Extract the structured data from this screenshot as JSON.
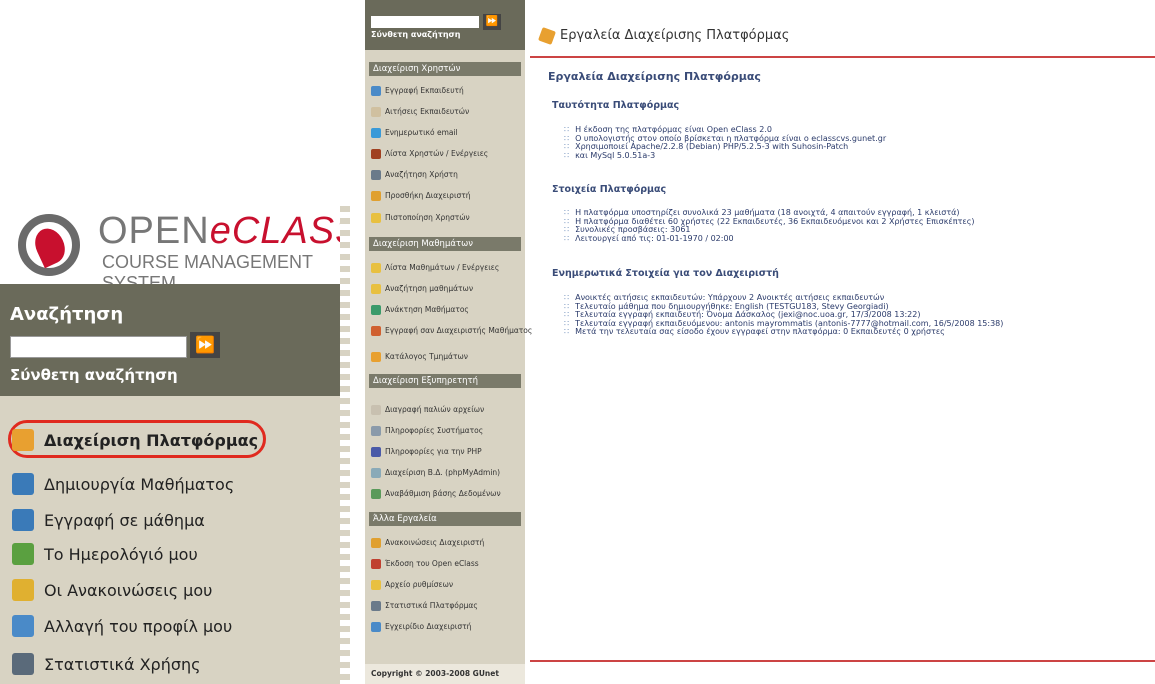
{
  "zoom": {
    "logo_main_a": "OPEN",
    "logo_main_b": "eCLASS",
    "logo_sub": "COURSE MANAGEMENT SYSTEM",
    "search_heading": "Αναζήτηση",
    "search_button": "⏩",
    "advanced_search": "Σύνθετη αναζήτηση",
    "menu": [
      {
        "label": "Διαχείριση Πλατφόρμας",
        "icon": "tools-icon",
        "color": "#e8a030"
      },
      {
        "label": "Δημιουργία Μαθήματος",
        "icon": "course-icon",
        "color": "#3a7ab8"
      },
      {
        "label": "Εγγραφή σε μάθημα",
        "icon": "enroll-icon",
        "color": "#3a7ab8"
      },
      {
        "label": "Το Ημερολόγιό μου",
        "icon": "calendar-icon",
        "color": "#5aa040"
      },
      {
        "label": "Οι Ανακοινώσεις μου",
        "icon": "announcement-icon",
        "color": "#e0b030"
      },
      {
        "label": "Αλλαγή του προφίλ μου",
        "icon": "profile-icon",
        "color": "#4a8ac8"
      },
      {
        "label": "Στατιστικά Χρήσης",
        "icon": "stats-icon",
        "color": "#5a6a7a"
      }
    ]
  },
  "sidebar": {
    "search_button": "⏩",
    "advanced_search": "Σύνθετη αναζήτηση",
    "sections": [
      {
        "title": "Διαχείριση Χρηστών",
        "items": [
          {
            "label": "Εγγραφή Εκπαιδευτή",
            "color": "#4a8ac8"
          },
          {
            "label": "Αιτήσεις Εκπαιδευτών",
            "color": "#d0c0a0"
          },
          {
            "label": "Ενημερωτικό email",
            "color": "#3a9ad8"
          },
          {
            "label": "Λίστα Χρηστών / Ενέργειες",
            "color": "#a04020"
          },
          {
            "label": "Αναζήτηση Χρήστη",
            "color": "#6a7a8a"
          },
          {
            "label": "Προσθήκη Διαχειριστή",
            "color": "#e0a030"
          },
          {
            "label": "Πιστοποίηση Χρηστών",
            "color": "#e8c040"
          }
        ]
      },
      {
        "title": "Διαχείριση Μαθημάτων",
        "items": [
          {
            "label": "Λίστα Μαθημάτων / Ενέργειες",
            "color": "#e8c040"
          },
          {
            "label": "Αναζήτηση μαθημάτων",
            "color": "#e8c040"
          },
          {
            "label": "Ανάκτηση Μαθήματος",
            "color": "#3a9a6a"
          },
          {
            "label": "Εγγραφή σαν Διαχειριστής Μαθήματος",
            "color": "#d06030"
          },
          {
            "label": "Κατάλογος Τμημάτων",
            "color": "#e8a030"
          }
        ]
      },
      {
        "title": "Διαχείριση Εξυπηρετητή",
        "items": [
          {
            "label": "Διαγραφή παλιών αρχείων",
            "color": "#c8c0b0"
          },
          {
            "label": "Πληροφορίες Συστήματος",
            "color": "#8a9aaa"
          },
          {
            "label": "Πληροφορίες για την PHP",
            "color": "#4a5aa8"
          },
          {
            "label": "Διαχείριση Β.Δ. (phpMyAdmin)",
            "color": "#8aaab8"
          },
          {
            "label": "Αναβάθμιση βάσης Δεδομένων",
            "color": "#5a9a5a"
          }
        ]
      },
      {
        "title": "Άλλα Εργαλεία",
        "items": [
          {
            "label": "Ανακοινώσεις Διαχειριστή",
            "color": "#e0a030"
          },
          {
            "label": "Έκδοση του Open eClass",
            "color": "#c04030"
          },
          {
            "label": "Αρχείο ρυθμίσεων",
            "color": "#e8c040"
          },
          {
            "label": "Στατιστικά Πλατφόρμας",
            "color": "#6a7a8a"
          },
          {
            "label": "Εγχειρίδιο Διαχειριστή",
            "color": "#4a8ac8"
          }
        ]
      }
    ],
    "footer": "Copyright © 2003-2008 GUnet"
  },
  "main": {
    "header_title": "Εργαλεία Διαχείρισης Πλατφόρμας",
    "page_title": "Εργαλεία Διαχείρισης Πλατφόρμας",
    "sections": [
      {
        "title": "Ταυτότητα Πλατφόρμας",
        "lines": [
          "Η έκδοση της πλατφόρμας είναι Open eClass 2.0",
          "Ο υπολογιστής στον οποίο βρίσκεται η πλατφόρμα είναι ο eclasscvs.gunet.gr",
          "Χρησιμοποιεί Apache/2.2.8 (Debian) PHP/5.2.5-3 with Suhosin-Patch",
          "και MySql 5.0.51a-3"
        ]
      },
      {
        "title": "Στοιχεία Πλατφόρμας",
        "lines": [
          "Η πλατφόρμα υποστηρίζει συνολικά 23 μαθήματα (18 ανοιχτά, 4 απαιτούν εγγραφή, 1 κλειστά)",
          "Η πλατφόρμα διαθέτει 60 χρήστες (22 Εκπαιδευτές, 36 Εκπαιδευόμενοι και 2 Χρήστες Επισκέπτες)",
          "Συνολικές προσβάσεις: 3061",
          "Λειτουργεί από τις: 01-01-1970 / 02:00"
        ]
      },
      {
        "title": "Ενημερωτικά Στοιχεία για τον Διαχειριστή",
        "lines": [
          "Ανοικτές αιτήσεις εκπαιδευτών: Υπάρχουν 2 Ανοικτές αιτήσεις εκπαιδευτών",
          "Τελευταίο μάθημα που δημιουργήθηκε: English (TESTGU183, Stevy Georgiadi)",
          "Τελευταία εγγραφή εκπαιδευτή: Όνομα Δάσκαλος (jexi@noc.uoa.gr, 17/3/2008 13:22)",
          "Τελευταία εγγραφή εκπαιδευόμενου: antonis mayrommatis (antonis-7777@hotmail.com, 16/5/2008 15:38)",
          "Μετά την τελευταία σας είσοδο έχουν εγγραφεί στην πλατφόρμα: 0 Εκπαιδευτές 0 χρήστες"
        ]
      }
    ]
  }
}
